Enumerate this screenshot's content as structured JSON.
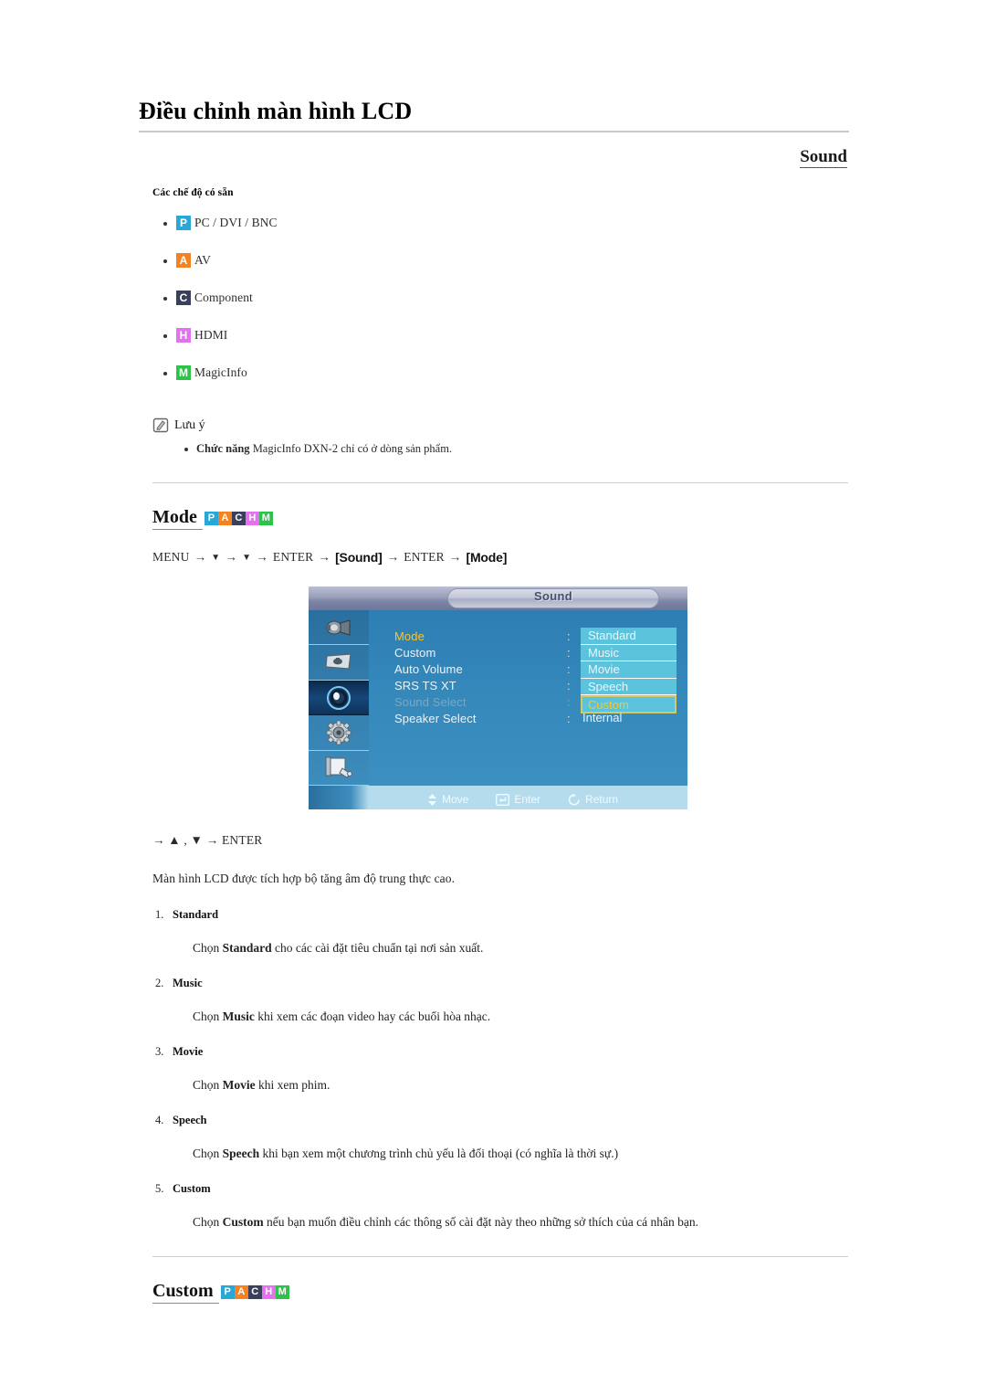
{
  "header": {
    "title": "Điều chỉnh màn hình LCD",
    "section": "Sound"
  },
  "available_modes": {
    "label": "Các chế độ có sẵn",
    "items": [
      {
        "badge": "P",
        "label": "PC / DVI / BNC",
        "color": "#29a8d8"
      },
      {
        "badge": "A",
        "label": "AV",
        "color": "#f58220"
      },
      {
        "badge": "C",
        "label": "Component",
        "color": "#3a3f5c"
      },
      {
        "badge": "H",
        "label": "HDMI",
        "color": "#e472ef"
      },
      {
        "badge": "M",
        "label": "MagicInfo",
        "color": "#2ec24a"
      }
    ]
  },
  "note": {
    "title": "Lưu ý",
    "icon": "note-pencil-icon",
    "items": [
      {
        "bold": "Chức năng",
        "rest": " MagicInfo DXN-2 chỉ có ở dòng sản phẩm."
      }
    ]
  },
  "mode_section": {
    "heading": "Mode",
    "badges": [
      {
        "letter": "P",
        "color": "#29a8d8"
      },
      {
        "letter": "A",
        "color": "#f58220"
      },
      {
        "letter": "C",
        "color": "#3a3f5c"
      },
      {
        "letter": "H",
        "color": "#e472ef"
      },
      {
        "letter": "M",
        "color": "#2ec24a"
      }
    ],
    "menu_path": {
      "start": "MENU",
      "down1": "▼",
      "down2": "▼",
      "enter1": "ENTER",
      "token1": "[Sound]",
      "enter2": "ENTER",
      "token2": "[Mode]"
    },
    "key_path": "→ ▲ , ▼ → ENTER",
    "description": "Màn hình LCD được tích hợp bộ tăng âm độ trung thực cao.",
    "items": [
      {
        "title": "Standard",
        "body_pre": "Chọn ",
        "body_bold": "Standard",
        "body_post": " cho các cài đặt tiêu chuẩn tại nơi sản xuất."
      },
      {
        "title": "Music",
        "body_pre": "Chọn ",
        "body_bold": "Music",
        "body_post": " khi xem các đoạn video hay các buổi hòa nhạc."
      },
      {
        "title": "Movie",
        "body_pre": "Chọn ",
        "body_bold": "Movie",
        "body_post": " khi xem phim."
      },
      {
        "title": "Speech",
        "body_pre": "Chọn ",
        "body_bold": "Speech",
        "body_post": " khi bạn xem một chương trình chủ yếu là đối thoại (có nghĩa là thời sự.)"
      },
      {
        "title": "Custom",
        "body_pre": "Chọn ",
        "body_bold": "Custom",
        "body_post": " nếu bạn muốn điều chỉnh các thông số cài đặt này theo những sở thích của cá nhân bạn."
      }
    ]
  },
  "osd": {
    "title": "Sound",
    "sidebar_icons": [
      "input-source-icon",
      "picture-screen-icon",
      "sound-speaker-icon",
      "setup-gear-icon",
      "multi-control-icon"
    ],
    "active_sidebar_index": 2,
    "fields": [
      {
        "label": "Mode",
        "state": "selected"
      },
      {
        "label": "Custom",
        "state": "normal"
      },
      {
        "label": "Auto Volume",
        "state": "normal"
      },
      {
        "label": "SRS TS XT",
        "state": "normal"
      },
      {
        "label": "Sound Select",
        "state": "disabled"
      },
      {
        "label": "Speaker Select",
        "state": "normal"
      }
    ],
    "dropdown_options": [
      "Standard",
      "Music",
      "Movie",
      "Speech",
      "Custom"
    ],
    "dropdown_highlight": "Custom",
    "speaker_value": "Internal",
    "footer": [
      {
        "icon": "updown-arrow-icon",
        "label": "Move"
      },
      {
        "icon": "enter-key-icon",
        "label": "Enter"
      },
      {
        "icon": "return-arrow-icon",
        "label": "Return"
      }
    ],
    "colors": {
      "panel": "#3488ba",
      "dropdown": "#5cc3dd",
      "highlight_text": "#ffc51e",
      "footer": "#b4dcec"
    }
  },
  "custom_section": {
    "heading": "Custom",
    "badges": [
      {
        "letter": "P",
        "color": "#29a8d8"
      },
      {
        "letter": "A",
        "color": "#f58220"
      },
      {
        "letter": "C",
        "color": "#3a3f5c"
      },
      {
        "letter": "H",
        "color": "#e472ef"
      },
      {
        "letter": "M",
        "color": "#2ec24a"
      }
    ]
  }
}
